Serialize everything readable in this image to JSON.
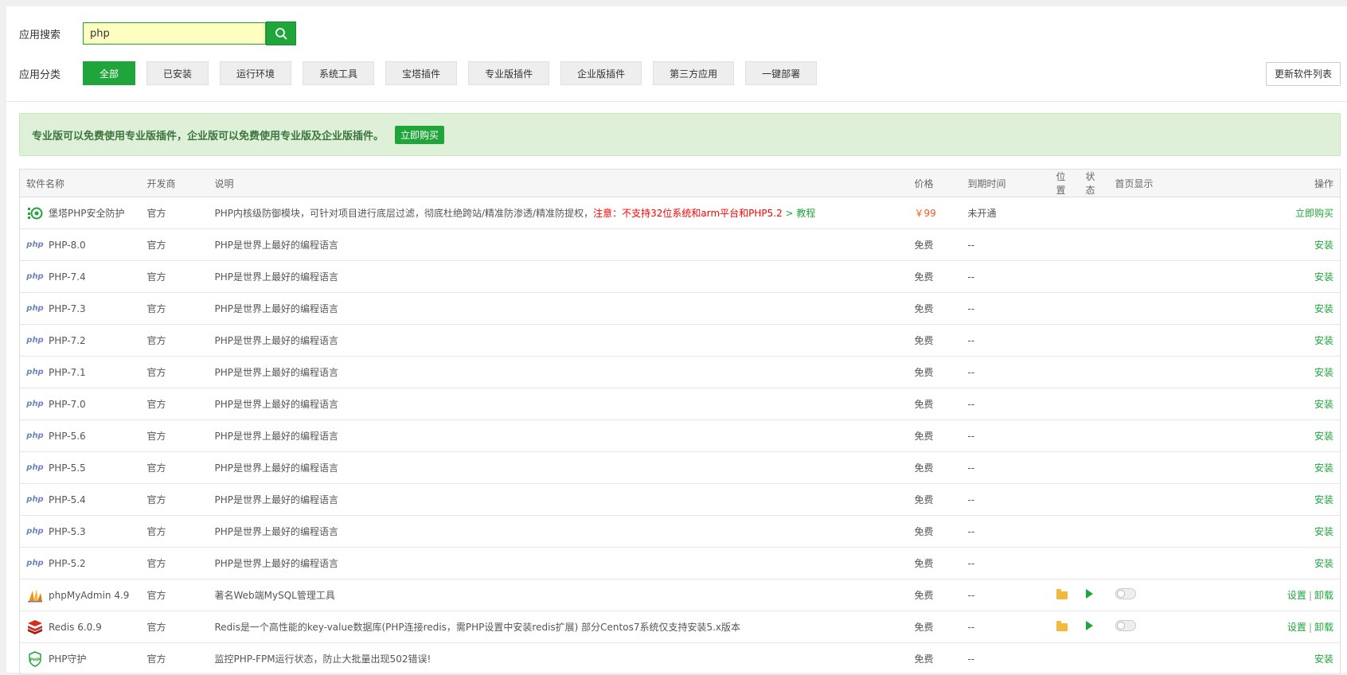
{
  "search": {
    "label": "应用搜索",
    "value": "php",
    "icon": "search-icon"
  },
  "categories": {
    "label": "应用分类",
    "items": [
      "全部",
      "已安装",
      "运行环境",
      "系统工具",
      "宝塔插件",
      "专业版插件",
      "企业版插件",
      "第三方应用",
      "一键部署"
    ],
    "active_index": 0
  },
  "refresh_label": "更新软件列表",
  "notice": {
    "text": "专业版可以免费使用专业版插件，企业版可以免费使用专业版及企业版插件。",
    "buy_label": "立即购买"
  },
  "table": {
    "headers": {
      "name": "软件名称",
      "dev": "开发商",
      "desc": "说明",
      "price": "价格",
      "expire": "到期时间",
      "location": "位置",
      "status": "状态",
      "home": "首页显示",
      "op": "操作"
    },
    "rows": [
      {
        "icon": "shield-plugin-icon",
        "name": "堡塔PHP安全防护",
        "dev": "官方",
        "desc": "PHP内核级防御模块，可针对项目进行底层过滤，彻底杜绝跨站/精准防渗透/精准防提权，",
        "warn": "注意：不支持32位系统和arm平台和PHP5.2",
        "link": "> 教程",
        "price": "￥99",
        "expire": "未开通",
        "op": "立即购买"
      },
      {
        "icon": "php-icon",
        "name": "PHP-8.0",
        "dev": "官方",
        "desc": "PHP是世界上最好的编程语言",
        "price": "免费",
        "expire": "--",
        "op": "安装"
      },
      {
        "icon": "php-icon",
        "name": "PHP-7.4",
        "dev": "官方",
        "desc": "PHP是世界上最好的编程语言",
        "price": "免费",
        "expire": "--",
        "op": "安装"
      },
      {
        "icon": "php-icon",
        "name": "PHP-7.3",
        "dev": "官方",
        "desc": "PHP是世界上最好的编程语言",
        "price": "免费",
        "expire": "--",
        "op": "安装"
      },
      {
        "icon": "php-icon",
        "name": "PHP-7.2",
        "dev": "官方",
        "desc": "PHP是世界上最好的编程语言",
        "price": "免费",
        "expire": "--",
        "op": "安装"
      },
      {
        "icon": "php-icon",
        "name": "PHP-7.1",
        "dev": "官方",
        "desc": "PHP是世界上最好的编程语言",
        "price": "免费",
        "expire": "--",
        "op": "安装"
      },
      {
        "icon": "php-icon",
        "name": "PHP-7.0",
        "dev": "官方",
        "desc": "PHP是世界上最好的编程语言",
        "price": "免费",
        "expire": "--",
        "op": "安装"
      },
      {
        "icon": "php-icon",
        "name": "PHP-5.6",
        "dev": "官方",
        "desc": "PHP是世界上最好的编程语言",
        "price": "免费",
        "expire": "--",
        "op": "安装"
      },
      {
        "icon": "php-icon",
        "name": "PHP-5.5",
        "dev": "官方",
        "desc": "PHP是世界上最好的编程语言",
        "price": "免费",
        "expire": "--",
        "op": "安装"
      },
      {
        "icon": "php-icon",
        "name": "PHP-5.4",
        "dev": "官方",
        "desc": "PHP是世界上最好的编程语言",
        "price": "免费",
        "expire": "--",
        "op": "安装"
      },
      {
        "icon": "php-icon",
        "name": "PHP-5.3",
        "dev": "官方",
        "desc": "PHP是世界上最好的编程语言",
        "price": "免费",
        "expire": "--",
        "op": "安装"
      },
      {
        "icon": "php-icon",
        "name": "PHP-5.2",
        "dev": "官方",
        "desc": "PHP是世界上最好的编程语言",
        "price": "免费",
        "expire": "--",
        "op": "安装"
      },
      {
        "icon": "phpmyadmin-icon",
        "name": "phpMyAdmin 4.9",
        "dev": "官方",
        "desc": "著名Web端MySQL管理工具",
        "price": "免费",
        "expire": "--",
        "installed": true,
        "op": "设置",
        "op2": "卸载"
      },
      {
        "icon": "redis-icon",
        "name": "Redis 6.0.9",
        "dev": "官方",
        "desc": "Redis是一个高性能的key-value数据库(PHP连接redis，需PHP设置中安装redis扩展) 部分Centos7系统仅支持安装5.x版本",
        "price": "免费",
        "expire": "--",
        "installed": true,
        "op": "设置",
        "op2": "卸载"
      },
      {
        "icon": "php-guard-icon",
        "name": "PHP守护",
        "dev": "官方",
        "desc": "监控PHP-FPM运行状态，防止大批量出现502错误!",
        "price": "免费",
        "expire": "--",
        "op": "安装"
      }
    ]
  },
  "colors": {
    "accent": "#20a53a",
    "price_red": "#ff5722",
    "warn_red": "#ff0000",
    "notice_bg": "#dff0d8"
  }
}
